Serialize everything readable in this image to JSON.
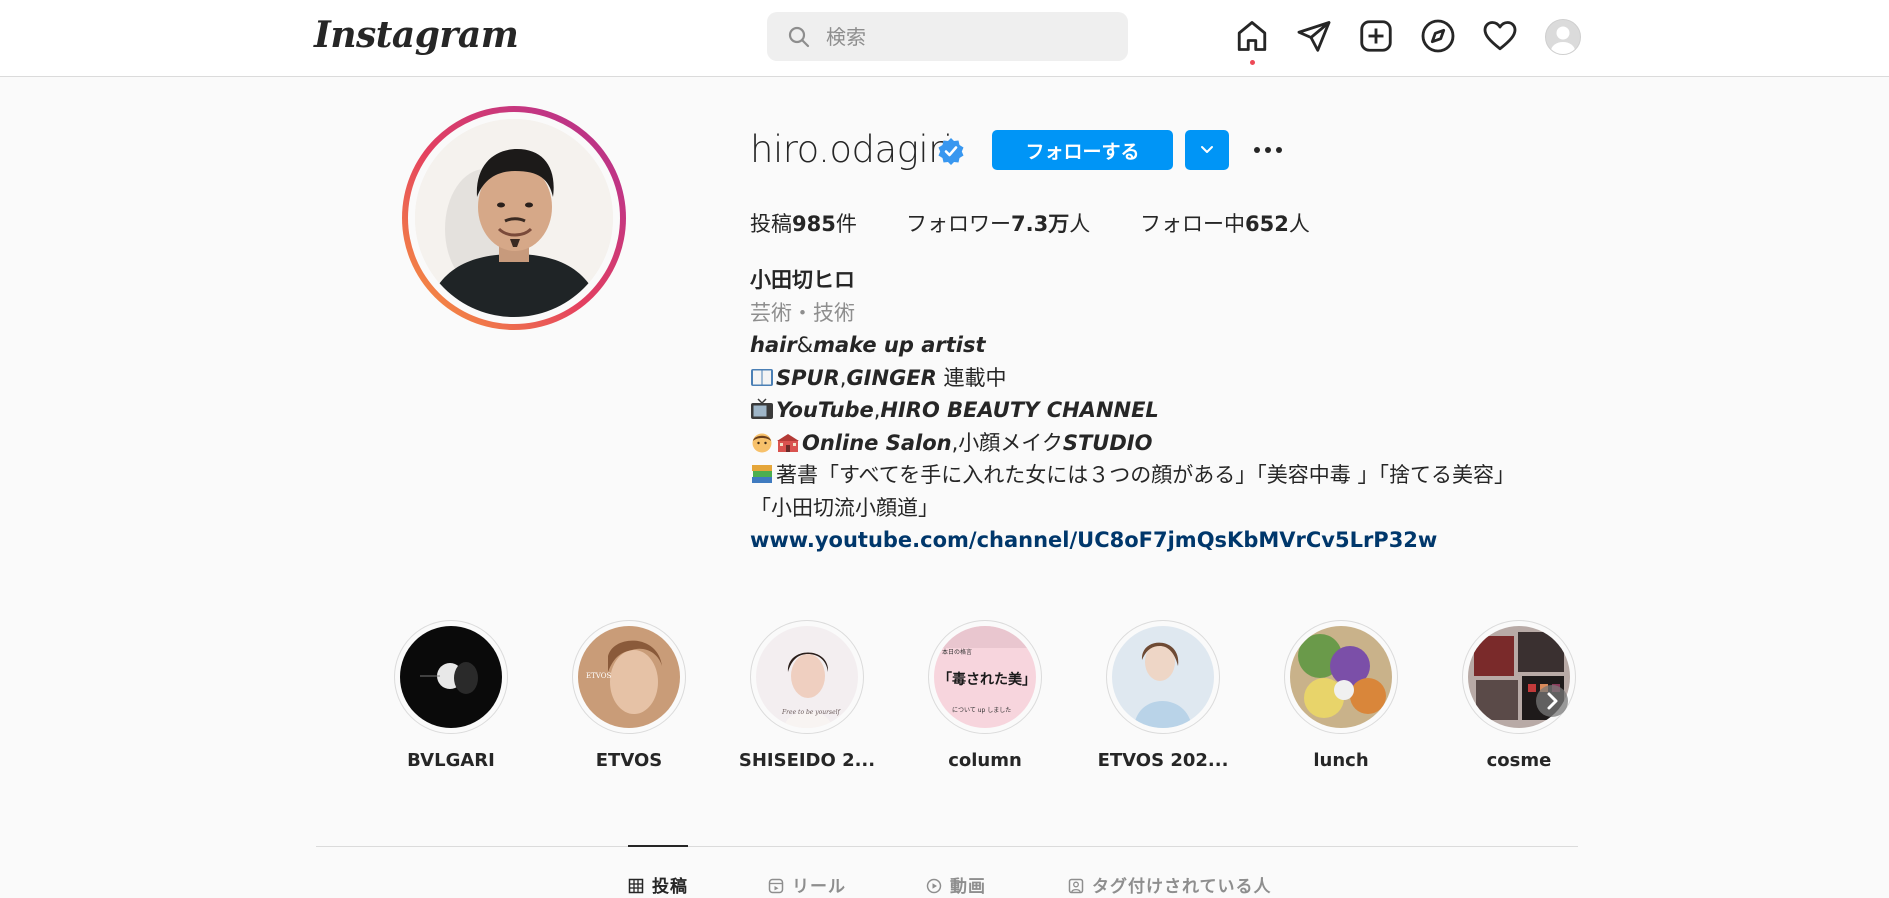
{
  "app": {
    "logo_text": "Instagram"
  },
  "search": {
    "placeholder": "検索"
  },
  "nav": {
    "icons": [
      "home-icon",
      "send-icon",
      "new-post-icon",
      "explore-icon",
      "heart-icon",
      "profile-avatar"
    ],
    "active_dot_color": "#ed4956"
  },
  "profile": {
    "username": "hiro.odagiri",
    "verified": true,
    "follow_label": "フォローする",
    "posts_label_pre": "投稿",
    "posts_count": "985",
    "posts_label_post": "件",
    "followers_label_pre": "フォロワー",
    "followers_count": "7.3万",
    "followers_label_post": "人",
    "following_label_pre": "フォロー中",
    "following_count": "652",
    "following_label_post": "人"
  },
  "bio": {
    "name": "小田切ヒロ",
    "category": "芸術・技術",
    "line1_a": "hair",
    "line1_b": "&",
    "line1_c": "make up artist",
    "line2_a": "SPUR",
    "line2_b": ",",
    "line2_c": "GINGER",
    "line2_d": " 連載中",
    "line3_a": "YouTube",
    "line3_b": ",",
    "line3_c": "HIRO BEAUTY CHANNEL",
    "line4_a": "Online Salon",
    "line4_b": ",小顔メイク",
    "line4_c": "STUDIO",
    "line5": "著書「すべてを手に入れた女には３つの顔がある」「美容中毒 」「捨てる美容」",
    "line6": "「小田切流小顔道」",
    "link": "www.youtube.com/channel/UC8oF7jmQsKbMVrCv5LrP32w"
  },
  "highlights": [
    {
      "label": "BVLGARI"
    },
    {
      "label": "ETVOS"
    },
    {
      "label": "SHISEIDO 2..."
    },
    {
      "label": "column",
      "thumb_text_top": "本日の格言",
      "thumb_text_main": "「毒された美」",
      "thumb_text_bottom": "について up しました"
    },
    {
      "label": "ETVOS 202..."
    },
    {
      "label": "lunch"
    },
    {
      "label": "cosme"
    }
  ],
  "thumb_texts": {
    "etvos_logo": "ETVOS",
    "shiseido_caption": "Free to be yourself"
  },
  "tabs": [
    {
      "label": "投稿",
      "icon": "grid-icon",
      "active": true
    },
    {
      "label": "リール",
      "icon": "reels-icon",
      "active": false
    },
    {
      "label": "動画",
      "icon": "video-icon",
      "active": false
    },
    {
      "label": "タグ付けされている人",
      "icon": "tagged-icon",
      "active": false
    }
  ],
  "colors": {
    "primary": "#0095f6",
    "link": "#00376b",
    "muted": "#8e8e8e",
    "border": "#dbdbdb"
  }
}
